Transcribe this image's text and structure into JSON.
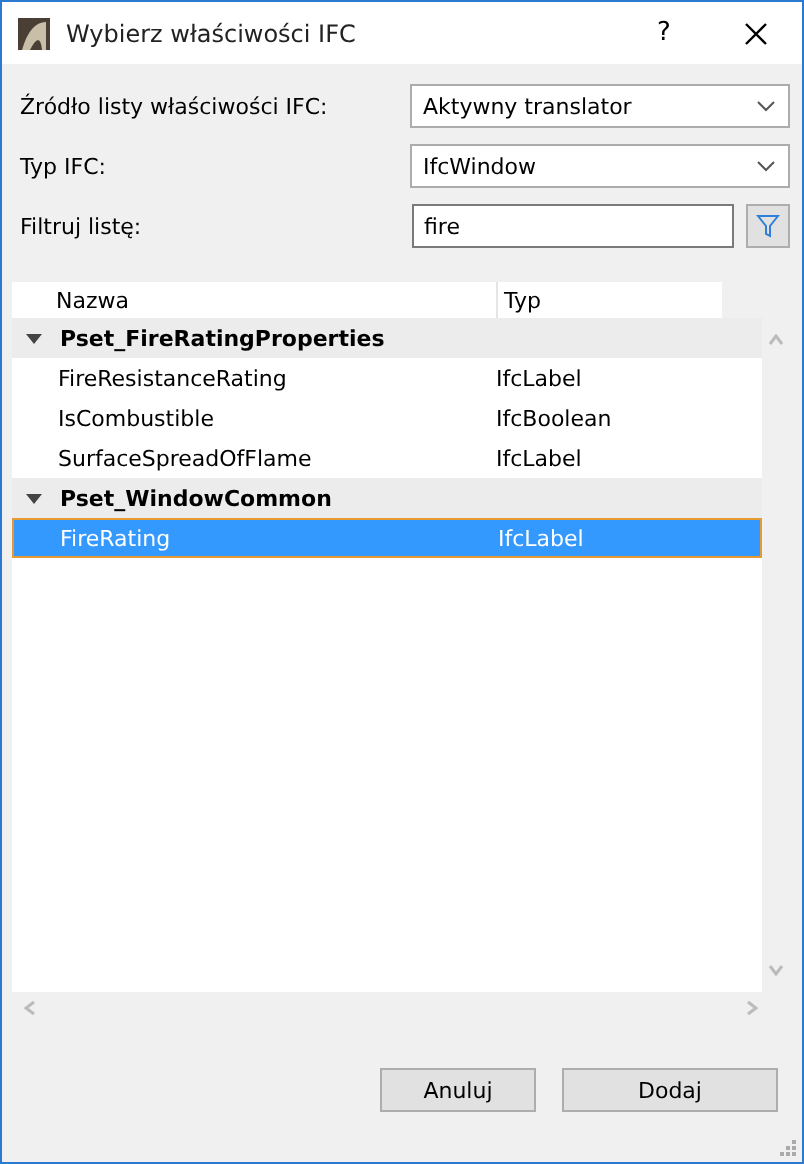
{
  "window": {
    "title": "Wybierz właściwości IFC",
    "help": "?"
  },
  "fields": [
    {
      "kind": "dropdown",
      "label": "Źródło listy właściwości IFC:",
      "value": "Aktywny translator"
    },
    {
      "kind": "dropdown",
      "label": "Typ IFC:",
      "value": "IfcWindow"
    },
    {
      "kind": "filter",
      "label": "Filtruj listę:",
      "value": "fire"
    }
  ],
  "table": {
    "columns": [
      "Nazwa",
      "Typ"
    ],
    "groups": [
      {
        "name": "Pset_FireRatingProperties",
        "expanded": true,
        "children": [
          {
            "name": "FireResistanceRating",
            "type": "IfcLabel",
            "selected": false
          },
          {
            "name": "IsCombustible",
            "type": "IfcBoolean",
            "selected": false
          },
          {
            "name": "SurfaceSpreadOfFlame",
            "type": "IfcLabel",
            "selected": false
          }
        ]
      },
      {
        "name": "Pset_WindowCommon",
        "expanded": true,
        "children": [
          {
            "name": "FireRating",
            "type": "IfcLabel",
            "selected": true
          }
        ]
      }
    ]
  },
  "buttons": [
    "Anuluj",
    "Dodaj"
  ]
}
